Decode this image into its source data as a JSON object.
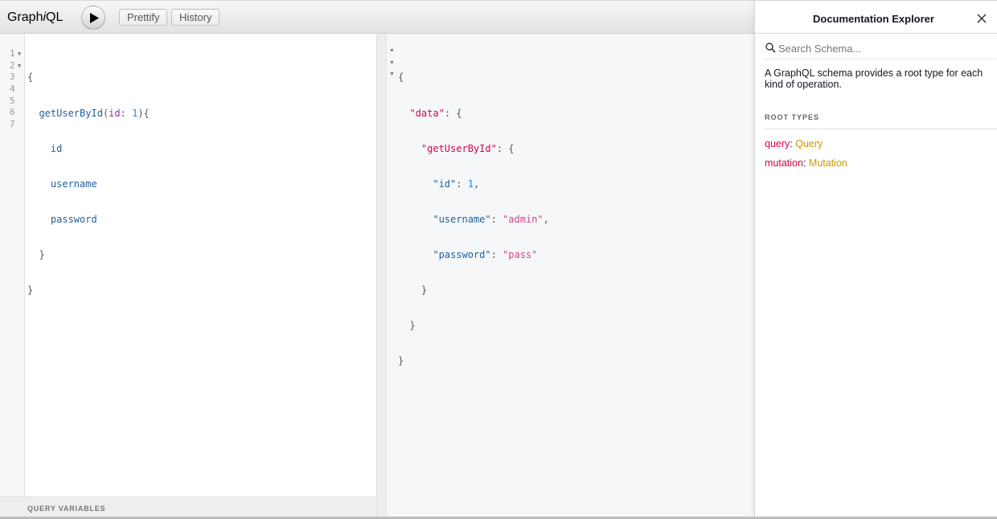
{
  "toolbar": {
    "logo_prefix": "Graph",
    "logo_italic": "i",
    "logo_suffix": "QL",
    "prettify_label": "Prettify",
    "history_label": "History"
  },
  "query_editor": {
    "line_numbers": [
      "1",
      "2",
      "3",
      "4",
      "5",
      "6",
      "7"
    ],
    "lines": [
      "{",
      "  getUserById(id: 1){",
      "    id",
      "    username",
      "    password",
      "  }",
      "}"
    ],
    "tokens": {
      "field_name": "getUserById",
      "arg_name": "id",
      "arg_value": "1",
      "fields": [
        "id",
        "username",
        "password"
      ]
    }
  },
  "variables_panel": {
    "label": "QUERY VARIABLES"
  },
  "result": {
    "lines": [
      "{",
      "  \"data\": {",
      "    \"getUserById\": {",
      "      \"id\": 1,",
      "      \"username\": \"admin\",",
      "      \"password\": \"pass\"",
      "    }",
      "  }",
      "}"
    ],
    "values": {
      "id": "1",
      "username": "admin",
      "password": "pass"
    }
  },
  "docs": {
    "title": "Documentation Explorer",
    "search_placeholder": "Search Schema...",
    "description": "A GraphQL schema provides a root type for each kind of operation.",
    "root_types_label": "ROOT TYPES",
    "root_types": [
      {
        "field": "query",
        "type": "Query"
      },
      {
        "field": "mutation",
        "type": "Mutation"
      }
    ]
  },
  "colors": {
    "field": "#1f61a0",
    "argument": "#8b2bb9",
    "number": "#2882f9",
    "json_key": "#d2054e",
    "json_string": "#d64292",
    "type_name": "#ca9800"
  },
  "icons": {
    "run": "play-icon",
    "close": "close-icon",
    "search": "search-icon",
    "fold": "fold-arrow-icon"
  }
}
